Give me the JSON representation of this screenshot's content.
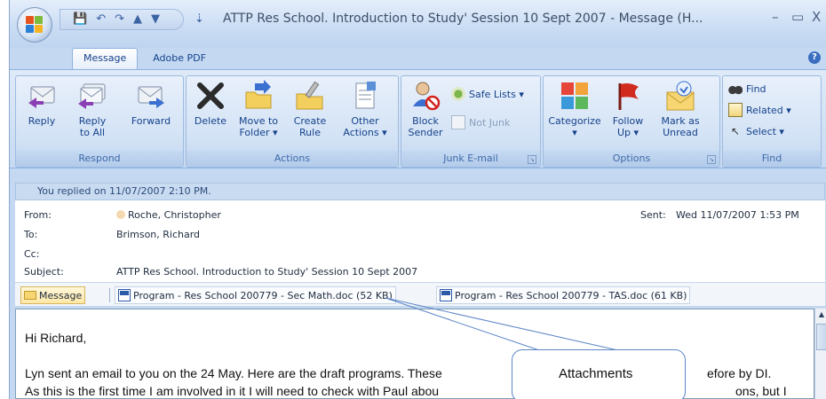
{
  "window": {
    "title": "ATTP Res School. Introduction to Study' Session 10 Sept 2007 - Message (H...",
    "minimize": "–",
    "maximize": "▭",
    "close": "X"
  },
  "quick_access": {
    "save": "💾",
    "undo": "↶",
    "redo": "↷",
    "up": "▲",
    "down": "▼",
    "customize": "⇣"
  },
  "tabs": [
    {
      "label": "Message"
    },
    {
      "label": "Adobe PDF"
    }
  ],
  "help": "?",
  "ribbon": {
    "respond": {
      "label": "Respond",
      "buttons": [
        {
          "label": "Reply"
        },
        {
          "label": "Reply\nto All"
        },
        {
          "label": "Forward"
        }
      ]
    },
    "actions": {
      "label": "Actions",
      "buttons": [
        {
          "label": "Delete"
        },
        {
          "label": "Move to\nFolder ▾"
        },
        {
          "label": "Create\nRule"
        },
        {
          "label": "Other\nActions ▾"
        }
      ]
    },
    "junk": {
      "label": "Junk E-mail",
      "block": "Block\nSender",
      "safe_lists": "Safe Lists ▾",
      "not_junk": "Not Junk"
    },
    "options": {
      "label": "Options",
      "buttons": [
        {
          "label": "Categorize\n▾"
        },
        {
          "label": "Follow\nUp ▾"
        },
        {
          "label": "Mark as\nUnread"
        }
      ]
    },
    "find": {
      "label": "Find",
      "find": "Find",
      "related": "Related ▾",
      "select": "Select ▾"
    }
  },
  "info_bar": "You replied on 11/07/2007 2:10 PM.",
  "header": {
    "from_label": "From:",
    "from_value": "Roche, Christopher",
    "sent_label": "Sent:",
    "sent_value": "Wed 11/07/2007 1:53 PM",
    "to_label": "To:",
    "to_value": "Brimson, Richard",
    "cc_label": "Cc:",
    "cc_value": "",
    "subject_label": "Subject:",
    "subject_value": "ATTP Res School. Introduction to Study' Session 10 Sept 2007"
  },
  "attachments": {
    "message_label": "Message",
    "files": [
      {
        "label": "Program - Res School 200779 - Sec Math.doc (52 KB)"
      },
      {
        "label": "Program - Res School 200779 - TAS.doc (61 KB)"
      }
    ]
  },
  "body": {
    "greeting": "Hi Richard,",
    "line1": "Lyn sent an email to you on the 24 May. Here are the draft programs. These",
    "line1_tail": "efore by DI.",
    "line2": "As this is the first time I am involved in it I will need to check with Paul abou",
    "line2_tail": "ons, but I"
  },
  "callout": {
    "text": "Attachments"
  }
}
